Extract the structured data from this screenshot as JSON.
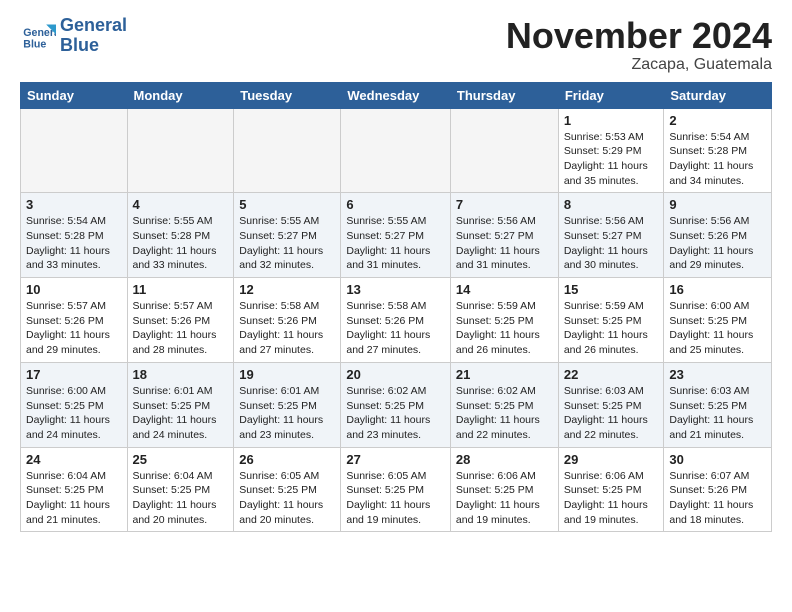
{
  "header": {
    "logo_line1": "General",
    "logo_line2": "Blue",
    "month_title": "November 2024",
    "location": "Zacapa, Guatemala"
  },
  "weekdays": [
    "Sunday",
    "Monday",
    "Tuesday",
    "Wednesday",
    "Thursday",
    "Friday",
    "Saturday"
  ],
  "weeks": [
    [
      {
        "day": "",
        "info": ""
      },
      {
        "day": "",
        "info": ""
      },
      {
        "day": "",
        "info": ""
      },
      {
        "day": "",
        "info": ""
      },
      {
        "day": "",
        "info": ""
      },
      {
        "day": "1",
        "info": "Sunrise: 5:53 AM\nSunset: 5:29 PM\nDaylight: 11 hours\nand 35 minutes."
      },
      {
        "day": "2",
        "info": "Sunrise: 5:54 AM\nSunset: 5:28 PM\nDaylight: 11 hours\nand 34 minutes."
      }
    ],
    [
      {
        "day": "3",
        "info": "Sunrise: 5:54 AM\nSunset: 5:28 PM\nDaylight: 11 hours\nand 33 minutes."
      },
      {
        "day": "4",
        "info": "Sunrise: 5:55 AM\nSunset: 5:28 PM\nDaylight: 11 hours\nand 33 minutes."
      },
      {
        "day": "5",
        "info": "Sunrise: 5:55 AM\nSunset: 5:27 PM\nDaylight: 11 hours\nand 32 minutes."
      },
      {
        "day": "6",
        "info": "Sunrise: 5:55 AM\nSunset: 5:27 PM\nDaylight: 11 hours\nand 31 minutes."
      },
      {
        "day": "7",
        "info": "Sunrise: 5:56 AM\nSunset: 5:27 PM\nDaylight: 11 hours\nand 31 minutes."
      },
      {
        "day": "8",
        "info": "Sunrise: 5:56 AM\nSunset: 5:27 PM\nDaylight: 11 hours\nand 30 minutes."
      },
      {
        "day": "9",
        "info": "Sunrise: 5:56 AM\nSunset: 5:26 PM\nDaylight: 11 hours\nand 29 minutes."
      }
    ],
    [
      {
        "day": "10",
        "info": "Sunrise: 5:57 AM\nSunset: 5:26 PM\nDaylight: 11 hours\nand 29 minutes."
      },
      {
        "day": "11",
        "info": "Sunrise: 5:57 AM\nSunset: 5:26 PM\nDaylight: 11 hours\nand 28 minutes."
      },
      {
        "day": "12",
        "info": "Sunrise: 5:58 AM\nSunset: 5:26 PM\nDaylight: 11 hours\nand 27 minutes."
      },
      {
        "day": "13",
        "info": "Sunrise: 5:58 AM\nSunset: 5:26 PM\nDaylight: 11 hours\nand 27 minutes."
      },
      {
        "day": "14",
        "info": "Sunrise: 5:59 AM\nSunset: 5:25 PM\nDaylight: 11 hours\nand 26 minutes."
      },
      {
        "day": "15",
        "info": "Sunrise: 5:59 AM\nSunset: 5:25 PM\nDaylight: 11 hours\nand 26 minutes."
      },
      {
        "day": "16",
        "info": "Sunrise: 6:00 AM\nSunset: 5:25 PM\nDaylight: 11 hours\nand 25 minutes."
      }
    ],
    [
      {
        "day": "17",
        "info": "Sunrise: 6:00 AM\nSunset: 5:25 PM\nDaylight: 11 hours\nand 24 minutes."
      },
      {
        "day": "18",
        "info": "Sunrise: 6:01 AM\nSunset: 5:25 PM\nDaylight: 11 hours\nand 24 minutes."
      },
      {
        "day": "19",
        "info": "Sunrise: 6:01 AM\nSunset: 5:25 PM\nDaylight: 11 hours\nand 23 minutes."
      },
      {
        "day": "20",
        "info": "Sunrise: 6:02 AM\nSunset: 5:25 PM\nDaylight: 11 hours\nand 23 minutes."
      },
      {
        "day": "21",
        "info": "Sunrise: 6:02 AM\nSunset: 5:25 PM\nDaylight: 11 hours\nand 22 minutes."
      },
      {
        "day": "22",
        "info": "Sunrise: 6:03 AM\nSunset: 5:25 PM\nDaylight: 11 hours\nand 22 minutes."
      },
      {
        "day": "23",
        "info": "Sunrise: 6:03 AM\nSunset: 5:25 PM\nDaylight: 11 hours\nand 21 minutes."
      }
    ],
    [
      {
        "day": "24",
        "info": "Sunrise: 6:04 AM\nSunset: 5:25 PM\nDaylight: 11 hours\nand 21 minutes."
      },
      {
        "day": "25",
        "info": "Sunrise: 6:04 AM\nSunset: 5:25 PM\nDaylight: 11 hours\nand 20 minutes."
      },
      {
        "day": "26",
        "info": "Sunrise: 6:05 AM\nSunset: 5:25 PM\nDaylight: 11 hours\nand 20 minutes."
      },
      {
        "day": "27",
        "info": "Sunrise: 6:05 AM\nSunset: 5:25 PM\nDaylight: 11 hours\nand 19 minutes."
      },
      {
        "day": "28",
        "info": "Sunrise: 6:06 AM\nSunset: 5:25 PM\nDaylight: 11 hours\nand 19 minutes."
      },
      {
        "day": "29",
        "info": "Sunrise: 6:06 AM\nSunset: 5:25 PM\nDaylight: 11 hours\nand 19 minutes."
      },
      {
        "day": "30",
        "info": "Sunrise: 6:07 AM\nSunset: 5:26 PM\nDaylight: 11 hours\nand 18 minutes."
      }
    ]
  ]
}
